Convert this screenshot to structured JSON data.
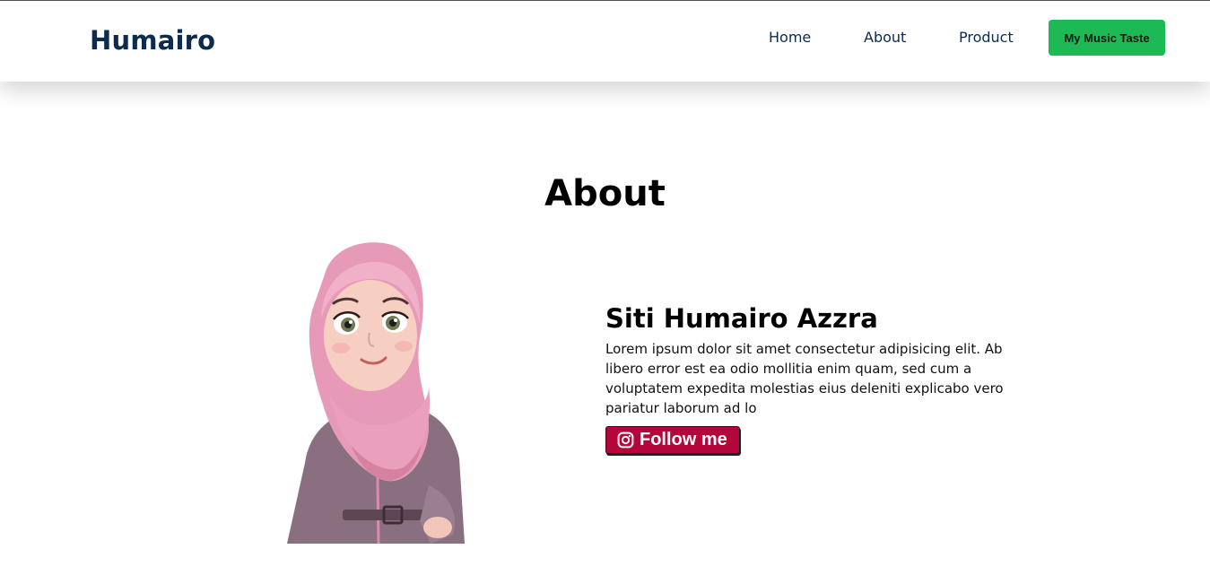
{
  "header": {
    "brand": "Humairo",
    "nav": {
      "home": "Home",
      "about": "About",
      "product": "Product"
    },
    "cta_label": "My Music Taste"
  },
  "about": {
    "title": "About",
    "name": "Siti Humairo Azzra",
    "bio": "Lorem ipsum dolor sit amet consectetur adipisicing elit. Ab libero error est ea odio mollitia enim quam, sed cum a voluptatem expedita molestias eius deleniti explicabo vero pariatur laborum ad lo",
    "follow_label": "Follow me",
    "follow_icon": "instagram-icon"
  },
  "colors": {
    "brand": "#0d2a4f",
    "cta": "#1db954",
    "follow": "#b3063a"
  }
}
